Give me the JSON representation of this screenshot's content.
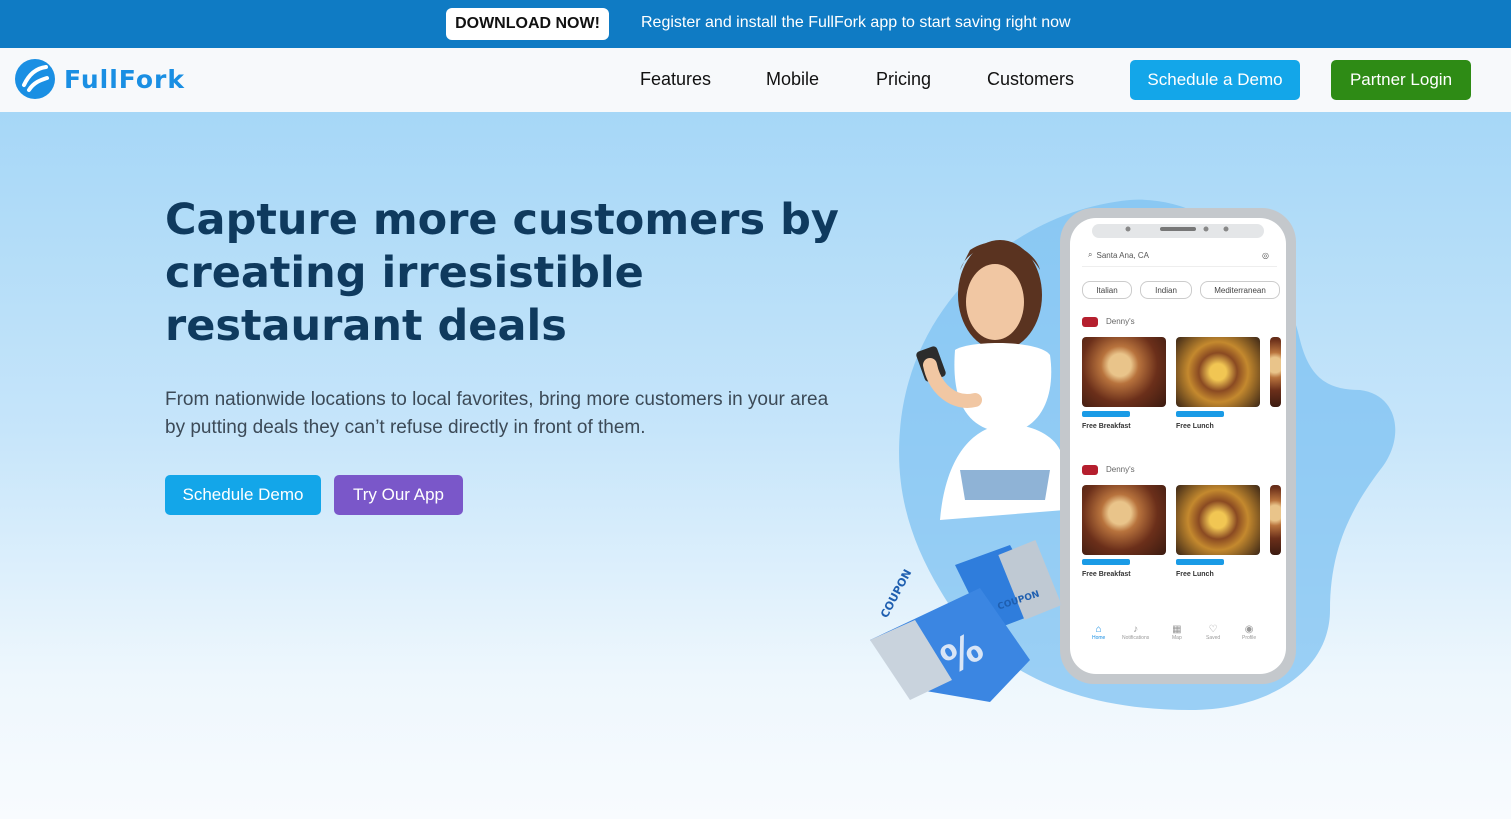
{
  "topbar": {
    "download_label": "DOWNLOAD NOW!",
    "message": "Register and install the FullFork app to start saving right now"
  },
  "brand": {
    "name": "FullFork",
    "color": "#1a8fe3"
  },
  "nav": {
    "links": [
      "Features",
      "Mobile",
      "Pricing",
      "Customers"
    ],
    "schedule_demo": "Schedule a Demo",
    "partner_login": "Partner Login"
  },
  "hero": {
    "headline": "Capture more customers by creating irresistible restaurant deals",
    "subtext": "From nationwide locations to local favorites, bring more customers in your area by putting deals they can’t refuse directly in front of them.",
    "primary_cta": "Schedule Demo",
    "secondary_cta": "Try Our App"
  },
  "coupons": {
    "front_label": "COUPON",
    "back_label": "COUPON"
  },
  "phone": {
    "location": "Santa Ana, CA",
    "chips": [
      "Italian",
      "Indian",
      "Mediterranean"
    ],
    "sections": [
      {
        "restaurant": "Denny's",
        "deals": [
          "Free Breakfast",
          "Free Lunch"
        ]
      },
      {
        "restaurant": "Denny's",
        "deals": [
          "Free Breakfast",
          "Free Lunch"
        ]
      }
    ],
    "tabs": [
      "Home",
      "Notifications",
      "Map",
      "Saved",
      "Profile"
    ]
  },
  "colors": {
    "topbar": "#0f7bc4",
    "primary_button": "#13a6e9",
    "partner_button": "#2e8b15",
    "app_button": "#7a57c9",
    "headline": "#0f3a5e"
  }
}
